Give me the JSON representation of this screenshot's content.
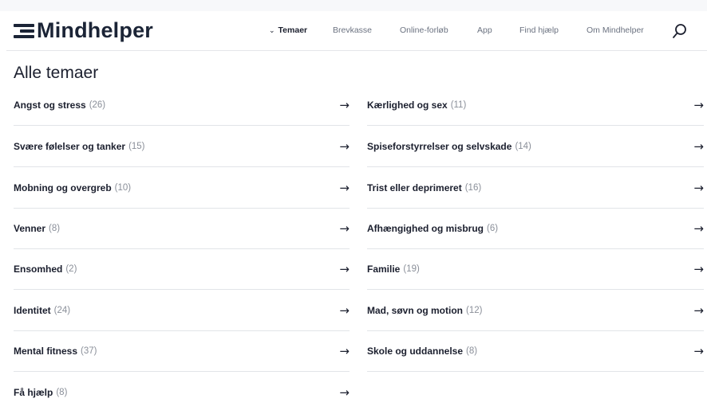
{
  "header": {
    "logo_text": "Mindhelper",
    "nav": [
      {
        "label": "Temaer",
        "active": true
      },
      {
        "label": "Brevkasse",
        "active": false
      },
      {
        "label": "Online-forløb",
        "active": false
      },
      {
        "label": "App",
        "active": false
      },
      {
        "label": "Find hjælp",
        "active": false
      },
      {
        "label": "Om Mindhelper",
        "active": false
      }
    ],
    "search_icon": "search-icon"
  },
  "page_title": "Alle temaer",
  "arrow": "→",
  "topics_left": [
    {
      "label": "Angst og stress",
      "count": "(26)"
    },
    {
      "label": "Svære følelser og tanker",
      "count": "(15)"
    },
    {
      "label": "Mobning og overgreb",
      "count": "(10)"
    },
    {
      "label": "Venner",
      "count": "(8)"
    },
    {
      "label": "Ensomhed",
      "count": "(2)"
    },
    {
      "label": "Identitet",
      "count": "(24)"
    },
    {
      "label": "Mental fitness",
      "count": "(37)"
    },
    {
      "label": "Få hjælp",
      "count": "(8)"
    }
  ],
  "topics_right": [
    {
      "label": "Kærlighed og sex",
      "count": "(11)"
    },
    {
      "label": "Spiseforstyrrelser og selvskade",
      "count": "(14)"
    },
    {
      "label": "Trist eller deprimeret",
      "count": "(16)"
    },
    {
      "label": "Afhængighed og misbrug",
      "count": "(6)"
    },
    {
      "label": "Familie",
      "count": "(19)"
    },
    {
      "label": "Mad, søvn og motion",
      "count": "(12)"
    },
    {
      "label": "Skole og uddannelse",
      "count": "(8)"
    }
  ]
}
